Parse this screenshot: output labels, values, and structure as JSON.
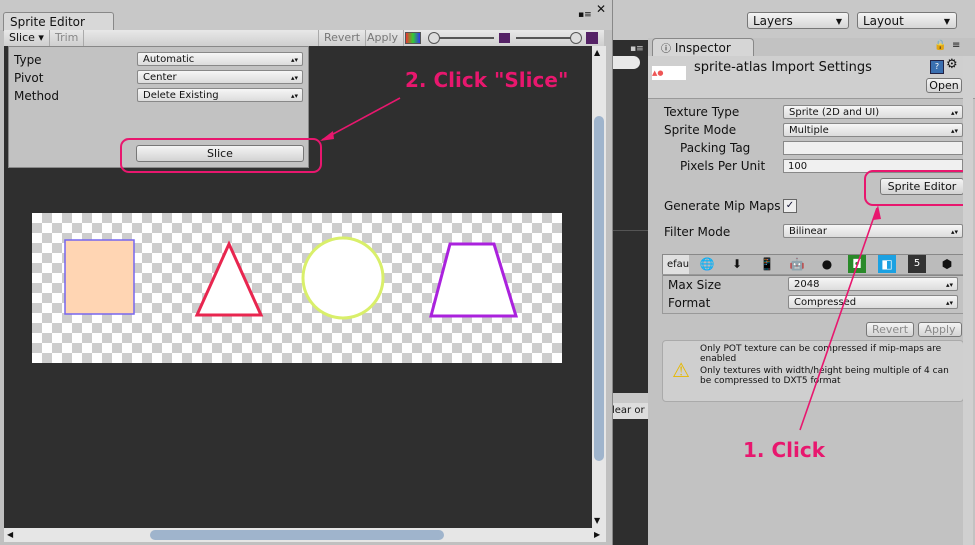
{
  "topbar": {
    "layers_label": "Layers",
    "layout_label": "Layout"
  },
  "strip": {
    "text_left": "",
    "clear_label": "lear or"
  },
  "inspector": {
    "tab_label": "Inspector",
    "title": "sprite-atlas Import Settings",
    "open_label": "Open",
    "texture_type_label": "Texture Type",
    "texture_type_value": "Sprite (2D and UI)",
    "sprite_mode_label": "Sprite Mode",
    "sprite_mode_value": "Multiple",
    "packing_tag_label": "Packing Tag",
    "packing_tag_value": "",
    "ppu_label": "Pixels Per Unit",
    "ppu_value": "100",
    "sprite_editor_label": "Sprite Editor",
    "mipmaps_label": "Generate Mip Maps",
    "mipmaps_checked": "✓",
    "filter_mode_label": "Filter Mode",
    "filter_mode_value": "Bilinear",
    "platform_default_label": "efau",
    "max_size_label": "Max Size",
    "max_size_value": "2048",
    "format_label": "Format",
    "format_value": "Compressed",
    "revert_label": "Revert",
    "apply_label": "Apply",
    "warning_line1": "Only POT texture can be compressed if mip-maps are enabled",
    "warning_line2": "Only textures with width/height being multiple of 4 can be compressed to DXT5 format"
  },
  "sprite_editor": {
    "tab_label": "Sprite Editor",
    "slice_label": "Slice ▾",
    "trim_label": "Trim",
    "revert_label": "Revert",
    "apply_label": "Apply",
    "type_label": "Type",
    "type_value": "Automatic",
    "pivot_label": "Pivot",
    "pivot_value": "Center",
    "method_label": "Method",
    "method_value": "Delete Existing",
    "slice_button_label": "Slice"
  },
  "annotations": {
    "step1": "1. Click",
    "step2": "2. Click \"Slice\""
  },
  "colors": {
    "annotation": "#e8176e",
    "square_fill": "#ffd5b3",
    "square_border": "#7766ee",
    "triangle": "#e8264f",
    "circle": "#d9ef6a",
    "trapezoid": "#aa22dd"
  }
}
